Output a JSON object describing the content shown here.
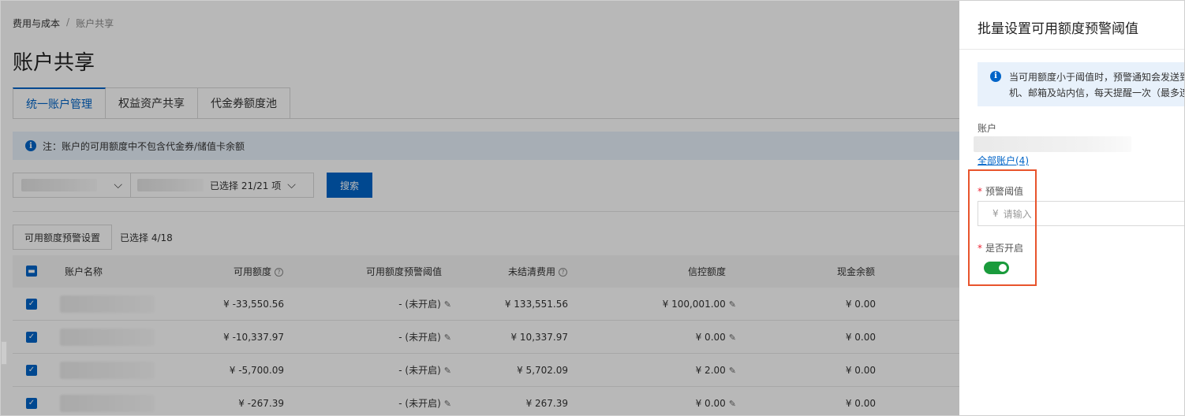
{
  "breadcrumb": {
    "root": "费用与成本",
    "separator": "/",
    "current": "账户共享"
  },
  "page_title": "账户共享",
  "tabs": [
    {
      "label": "统一账户管理",
      "active": true
    },
    {
      "label": "权益资产共享",
      "active": false
    },
    {
      "label": "代金券额度池",
      "active": false
    }
  ],
  "notice": "注：账户的可用额度中不包含代金券/储值卡余额",
  "filters": {
    "selected_count": "已选择 21/21 项",
    "search_label": "搜索"
  },
  "actions": {
    "set_button": "可用额度预警设置",
    "selected_text": "已选择 4/18"
  },
  "table": {
    "headers": {
      "name": "账户名称",
      "available": "可用额度",
      "threshold": "可用额度预警阈值",
      "unsettled": "未结清费用",
      "credit": "信控额度",
      "cash": "现金余额"
    },
    "rows": [
      {
        "available": "¥ -33,550.56",
        "threshold": "- (未开启)",
        "unsettled": "¥ 133,551.56",
        "credit": "¥ 100,001.00",
        "cash": "¥ 0.00"
      },
      {
        "available": "¥ -10,337.97",
        "threshold": "- (未开启)",
        "unsettled": "¥ 10,337.97",
        "credit": "¥ 0.00",
        "cash": "¥ 0.00"
      },
      {
        "available": "¥ -5,700.09",
        "threshold": "- (未开启)",
        "unsettled": "¥ 5,702.09",
        "credit": "¥ 2.00",
        "cash": "¥ 0.00"
      },
      {
        "available": "¥ -267.39",
        "threshold": "- (未开启)",
        "unsettled": "¥ 267.39",
        "credit": "¥ 0.00",
        "cash": "¥ 0.00"
      }
    ]
  },
  "drawer": {
    "title": "批量设置可用额度预警阈值",
    "notice_line1": "当可用额度小于阈值时，预警通知会发送到",
    "notice_line2": "机、邮箱及站内信，每天提醒一次（最多连",
    "account_label": "账户",
    "all_accounts_link": "全部账户(4)",
    "threshold_label": "预警阈值",
    "currency_symbol": "¥",
    "threshold_placeholder": "请输入",
    "enable_label": "是否开启",
    "required_mark": "*"
  },
  "colors": {
    "primary": "#0064c8",
    "toggle_on": "#1a9b3c",
    "highlight": "#e8542c"
  }
}
